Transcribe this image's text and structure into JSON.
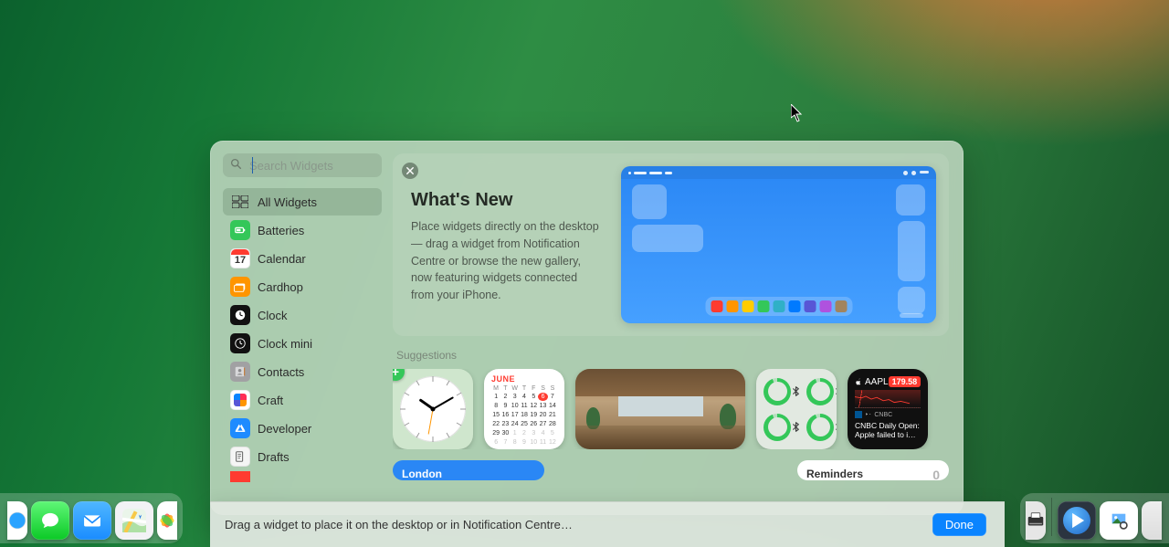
{
  "search": {
    "placeholder": "Search Widgets"
  },
  "sidebar": {
    "items": [
      {
        "label": "All Widgets"
      },
      {
        "label": "Batteries"
      },
      {
        "label": "Calendar",
        "icon_number": "17"
      },
      {
        "label": "Cardhop"
      },
      {
        "label": "Clock"
      },
      {
        "label": "Clock mini"
      },
      {
        "label": "Contacts"
      },
      {
        "label": "Craft"
      },
      {
        "label": "Developer"
      },
      {
        "label": "Drafts"
      }
    ]
  },
  "whatsnew": {
    "title": "What's New",
    "body": "Place widgets directly on the desktop — drag a widget from Notification Centre or browse the new gallery, now featuring widgets connected from your iPhone."
  },
  "suggestions_label": "Suggestions",
  "dock_colors": [
    "#ff3b30",
    "#ff9500",
    "#ffcc00",
    "#34c759",
    "#30b0c7",
    "#007aff",
    "#5856d6",
    "#af52de",
    "#a2845e"
  ],
  "tiles": {
    "calendar": {
      "month": "JUNE",
      "dow": [
        "M",
        "T",
        "W",
        "T",
        "F",
        "S",
        "S"
      ],
      "today": 6,
      "lead": 0,
      "days": 30
    },
    "stocks": {
      "symbol": "AAPL",
      "price": "179.58",
      "source": "CNBC",
      "headline": "CNBC Daily Open: Apple failed to i…"
    },
    "weather": {
      "city": "London"
    },
    "reminders": {
      "title": "Reminders",
      "count": "0"
    }
  },
  "bottom": {
    "hint": "Drag a widget to place it on the desktop or in Notification Centre…",
    "done": "Done"
  }
}
